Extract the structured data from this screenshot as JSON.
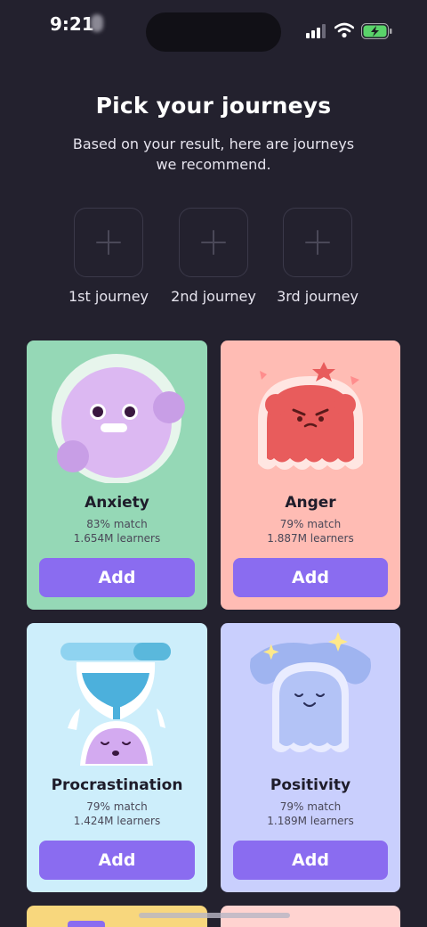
{
  "status_bar": {
    "time": "9:21",
    "icons": [
      "signal-icon",
      "wifi-icon",
      "battery-charging-icon"
    ]
  },
  "header": {
    "title": "Pick your journeys",
    "subtitle": "Based on your result, here are journeys we recommend."
  },
  "slots": [
    {
      "label": "1st journey",
      "icon": "plus-icon"
    },
    {
      "label": "2nd journey",
      "icon": "plus-icon"
    },
    {
      "label": "3rd journey",
      "icon": "plus-icon"
    }
  ],
  "cards": [
    {
      "title": "Anxiety",
      "match": "83% match",
      "learners": "1.654M learners",
      "button": "Add",
      "bg": "#95d8b6"
    },
    {
      "title": "Anger",
      "match": "79% match",
      "learners": "1.887M learners",
      "button": "Add",
      "bg": "#ffbcb4"
    },
    {
      "title": "Procrastination",
      "match": "79% match",
      "learners": "1.424M learners",
      "button": "Add",
      "bg": "#cdeefb"
    },
    {
      "title": "Positivity",
      "match": "79% match",
      "learners": "1.189M learners",
      "button": "Add",
      "bg": "#c9cffd"
    }
  ],
  "colors": {
    "background": "#23212e",
    "accent": "#8a6cf0",
    "partial_card_1": "#f8d77d",
    "partial_card_2": "#ffd3d0"
  }
}
